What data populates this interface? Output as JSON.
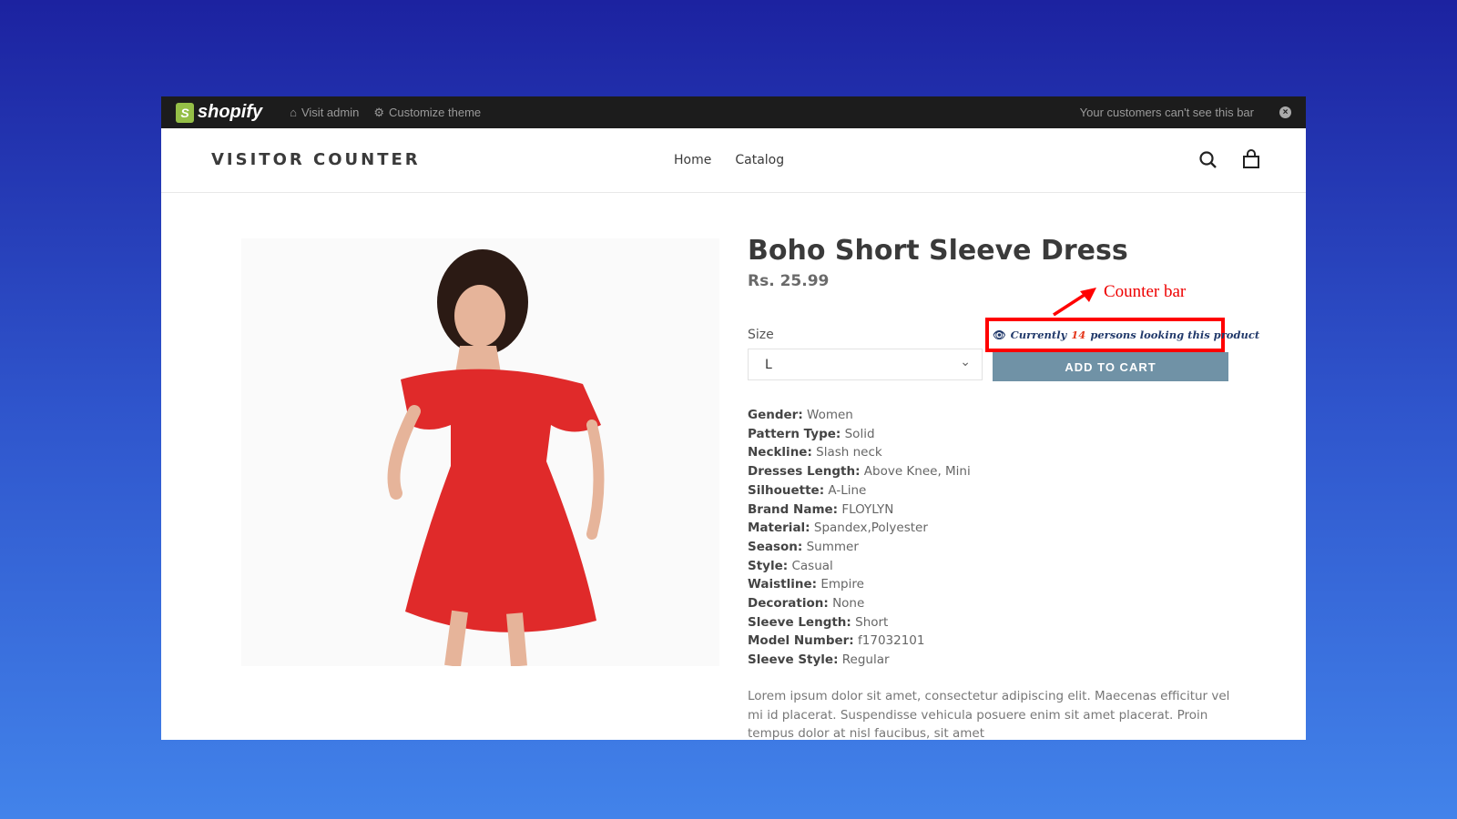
{
  "admin_bar": {
    "logo": "shopify",
    "visit_admin": "Visit admin",
    "customize_theme": "Customize theme",
    "notice": "Your customers can't see this bar",
    "close_icon": "close-circle-icon"
  },
  "header": {
    "brand": "VISITOR COUNTER",
    "nav": [
      {
        "label": "Home"
      },
      {
        "label": "Catalog"
      }
    ],
    "icons": [
      "search-icon",
      "cart-icon"
    ]
  },
  "product": {
    "title": "Boho Short Sleeve Dress",
    "price": "Rs. 25.99",
    "size_label": "Size",
    "size_value": "L",
    "add_to_cart": "ADD TO CART",
    "counter": {
      "prefix": "Currently",
      "count": "14",
      "suffix": "persons looking this product"
    },
    "specs": [
      {
        "k": "Gender:",
        "v": "Women"
      },
      {
        "k": "Pattern Type:",
        "v": "Solid"
      },
      {
        "k": "Neckline:",
        "v": "Slash neck"
      },
      {
        "k": "Dresses Length:",
        "v": "Above Knee, Mini"
      },
      {
        "k": "Silhouette:",
        "v": "A-Line"
      },
      {
        "k": "Brand Name:",
        "v": "FLOYLYN"
      },
      {
        "k": "Material:",
        "v": "Spandex,Polyester"
      },
      {
        "k": "Season:",
        "v": "Summer"
      },
      {
        "k": "Style:",
        "v": "Casual"
      },
      {
        "k": "Waistline:",
        "v": "Empire"
      },
      {
        "k": "Decoration:",
        "v": "None"
      },
      {
        "k": "Sleeve Length:",
        "v": "Short"
      },
      {
        "k": "Model Number:",
        "v": "f17032101"
      },
      {
        "k": "Sleeve Style:",
        "v": "Regular"
      }
    ],
    "description": "Lorem ipsum dolor sit amet, consectetur adipiscing elit. Maecenas efficitur vel mi id placerat. Suspendisse vehicula posuere enim sit amet placerat. Proin tempus dolor at nisl faucibus, sit amet"
  },
  "annotation": {
    "label": "Counter bar",
    "color": "#ff0000"
  }
}
